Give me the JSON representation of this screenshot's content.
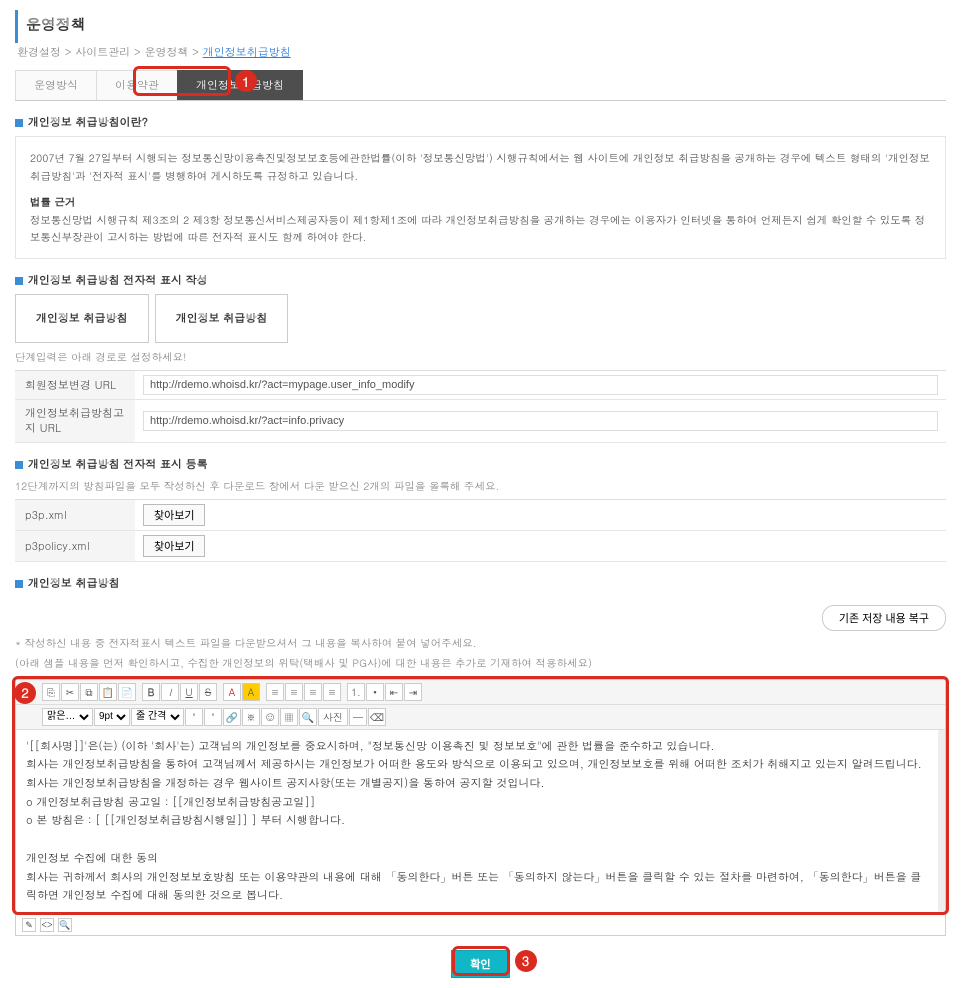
{
  "page": {
    "title": "운영정책"
  },
  "breadcrumb": {
    "parts": [
      "환경설정",
      "사이트관리",
      "운영정책"
    ],
    "current": "개인정보취급방침"
  },
  "tabs": {
    "items": [
      "운영방식",
      "이용약관",
      "개인정보취급방침"
    ],
    "active_index": 2
  },
  "markers": {
    "m1": "1",
    "m2": "2",
    "m3": "3"
  },
  "sec1": {
    "heading": "개인정보 취급방침이란?",
    "p1": "2007년 7월 27일부터 시행되는 정보통신망이용촉진및정보보호등에관한법률(이하 '정보통신망법') 시행규칙에서는 웹 사이트에 개인정보 취급방침을 공개하는 경우에 텍스트 형태의 '개인정보취급방침'과 '전자적 표시'를 병행하여 게시하도록 규정하고 있습니다.",
    "sub_h": "법률 근거",
    "p2": "정보통신망법 시행규칙 제3조의 2 제3항 정보통신서비스제공자등이 제1항제1조에 따라 개인정보취급방침을 공개하는 경우에는 이용자가 인터넷을 통하여 언제든지 쉽게 확인할 수 있도록 정보통신부장관이 고시하는 방법에 따른 전자적 표시도 함께 하여야 한다."
  },
  "sec2": {
    "heading": "개인정보 취급방침 전자적 표시 작성",
    "box1": "개인정보 취급방침",
    "box2": "개인정보 취급방침",
    "hint": "단계입력은 아래 경로로 설정하세요!",
    "rows": [
      {
        "label": "회원정보변경 URL",
        "value": "http://rdemo.whoisd.kr/?act=mypage.user_info_modify"
      },
      {
        "label": "개인정보취급방침고지 URL",
        "value": "http://rdemo.whoisd.kr/?act=info.privacy"
      }
    ]
  },
  "sec3": {
    "heading": "개인정보 취급방침 전자적 표시 등록",
    "hint": "12단계까지의 방침파일을 모두 작성하신 후 다운로드 창에서 다운 받으신 2개의 파일을 올록해 주세요.",
    "rows": [
      {
        "label": "p3p.xml",
        "btn": "찾아보기"
      },
      {
        "label": "p3policy.xml",
        "btn": "찾아보기"
      }
    ]
  },
  "sec4": {
    "heading": "개인정보 취급방침",
    "restore_btn": "기존 저장 내용 복구",
    "foot1": "* 작성하신 내용 중 전자적표시 텍스트 파일을 다운받으셔서 그 내용을 복사하여 붙여 넣어주세요.",
    "foot2": "(아래 샘플 내용을 먼저 확인하시고, 수집한 개인정보의 위탁(택배사 및 PG사)에 대한 내용은 추가로 기재하여 적용하세요)"
  },
  "editor": {
    "toolbar": {
      "font_label": "맑은…",
      "size_label": "9pt",
      "lh_label": "줄 간격",
      "image_label": "사진"
    },
    "body": {
      "l1": "'[[회사명]]'은(는) (이하 '회사'는) 고객님의 개인정보를 중요시하며, \"정보통신망 이용촉진 및 정보보호\"에 관한 법률을 준수하고 있습니다.",
      "l2": "회사는 개인정보취급방침을 통하여 고객님께서 제공하시는 개인정보가 어떠한 용도와 방식으로 이용되고 있으며, 개인정보보호를 위해 어떠한 조치가 취해지고 있는지 알려드립니다.",
      "l3": "회사는 개인정보취급방침을 개정하는 경우 웹사이트 공지사항(또는 개별공지)을 통하여 공지할 것입니다.",
      "l4": "ο 개인정보취급방침 공고일 : [[개인정보취급방침공고일]]",
      "l5": "ο 본 방침은 : [ [[개인정보취급방침시행일]] ] 부터 시행합니다.",
      "l6": "개인정보 수집에 대한 동의",
      "l7": "회사는 귀하께서 회사의 개인정보보호방침 또는 이용약관의 내용에 대해 「동의한다」버튼 또는 「동의하지 않는다」버튼을 클릭할 수 있는 절차를 마련하여, 「동의한다」버튼을 클릭하면 개인정보 수집에 대해 동의한 것으로 봅니다."
    }
  },
  "submit": {
    "label": "확인"
  }
}
